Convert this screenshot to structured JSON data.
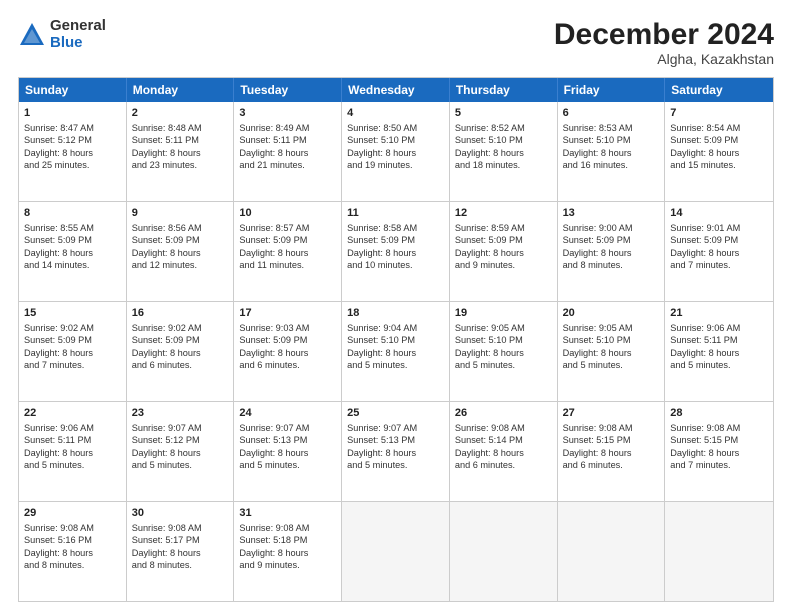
{
  "logo": {
    "general": "General",
    "blue": "Blue"
  },
  "title": "December 2024",
  "location": "Algha, Kazakhstan",
  "days_of_week": [
    "Sunday",
    "Monday",
    "Tuesday",
    "Wednesday",
    "Thursday",
    "Friday",
    "Saturday"
  ],
  "weeks": [
    [
      {
        "day": "1",
        "lines": [
          "Sunrise: 8:47 AM",
          "Sunset: 5:12 PM",
          "Daylight: 8 hours",
          "and 25 minutes."
        ]
      },
      {
        "day": "2",
        "lines": [
          "Sunrise: 8:48 AM",
          "Sunset: 5:11 PM",
          "Daylight: 8 hours",
          "and 23 minutes."
        ]
      },
      {
        "day": "3",
        "lines": [
          "Sunrise: 8:49 AM",
          "Sunset: 5:11 PM",
          "Daylight: 8 hours",
          "and 21 minutes."
        ]
      },
      {
        "day": "4",
        "lines": [
          "Sunrise: 8:50 AM",
          "Sunset: 5:10 PM",
          "Daylight: 8 hours",
          "and 19 minutes."
        ]
      },
      {
        "day": "5",
        "lines": [
          "Sunrise: 8:52 AM",
          "Sunset: 5:10 PM",
          "Daylight: 8 hours",
          "and 18 minutes."
        ]
      },
      {
        "day": "6",
        "lines": [
          "Sunrise: 8:53 AM",
          "Sunset: 5:10 PM",
          "Daylight: 8 hours",
          "and 16 minutes."
        ]
      },
      {
        "day": "7",
        "lines": [
          "Sunrise: 8:54 AM",
          "Sunset: 5:09 PM",
          "Daylight: 8 hours",
          "and 15 minutes."
        ]
      }
    ],
    [
      {
        "day": "8",
        "lines": [
          "Sunrise: 8:55 AM",
          "Sunset: 5:09 PM",
          "Daylight: 8 hours",
          "and 14 minutes."
        ]
      },
      {
        "day": "9",
        "lines": [
          "Sunrise: 8:56 AM",
          "Sunset: 5:09 PM",
          "Daylight: 8 hours",
          "and 12 minutes."
        ]
      },
      {
        "day": "10",
        "lines": [
          "Sunrise: 8:57 AM",
          "Sunset: 5:09 PM",
          "Daylight: 8 hours",
          "and 11 minutes."
        ]
      },
      {
        "day": "11",
        "lines": [
          "Sunrise: 8:58 AM",
          "Sunset: 5:09 PM",
          "Daylight: 8 hours",
          "and 10 minutes."
        ]
      },
      {
        "day": "12",
        "lines": [
          "Sunrise: 8:59 AM",
          "Sunset: 5:09 PM",
          "Daylight: 8 hours",
          "and 9 minutes."
        ]
      },
      {
        "day": "13",
        "lines": [
          "Sunrise: 9:00 AM",
          "Sunset: 5:09 PM",
          "Daylight: 8 hours",
          "and 8 minutes."
        ]
      },
      {
        "day": "14",
        "lines": [
          "Sunrise: 9:01 AM",
          "Sunset: 5:09 PM",
          "Daylight: 8 hours",
          "and 7 minutes."
        ]
      }
    ],
    [
      {
        "day": "15",
        "lines": [
          "Sunrise: 9:02 AM",
          "Sunset: 5:09 PM",
          "Daylight: 8 hours",
          "and 7 minutes."
        ]
      },
      {
        "day": "16",
        "lines": [
          "Sunrise: 9:02 AM",
          "Sunset: 5:09 PM",
          "Daylight: 8 hours",
          "and 6 minutes."
        ]
      },
      {
        "day": "17",
        "lines": [
          "Sunrise: 9:03 AM",
          "Sunset: 5:09 PM",
          "Daylight: 8 hours",
          "and 6 minutes."
        ]
      },
      {
        "day": "18",
        "lines": [
          "Sunrise: 9:04 AM",
          "Sunset: 5:10 PM",
          "Daylight: 8 hours",
          "and 5 minutes."
        ]
      },
      {
        "day": "19",
        "lines": [
          "Sunrise: 9:05 AM",
          "Sunset: 5:10 PM",
          "Daylight: 8 hours",
          "and 5 minutes."
        ]
      },
      {
        "day": "20",
        "lines": [
          "Sunrise: 9:05 AM",
          "Sunset: 5:10 PM",
          "Daylight: 8 hours",
          "and 5 minutes."
        ]
      },
      {
        "day": "21",
        "lines": [
          "Sunrise: 9:06 AM",
          "Sunset: 5:11 PM",
          "Daylight: 8 hours",
          "and 5 minutes."
        ]
      }
    ],
    [
      {
        "day": "22",
        "lines": [
          "Sunrise: 9:06 AM",
          "Sunset: 5:11 PM",
          "Daylight: 8 hours",
          "and 5 minutes."
        ]
      },
      {
        "day": "23",
        "lines": [
          "Sunrise: 9:07 AM",
          "Sunset: 5:12 PM",
          "Daylight: 8 hours",
          "and 5 minutes."
        ]
      },
      {
        "day": "24",
        "lines": [
          "Sunrise: 9:07 AM",
          "Sunset: 5:13 PM",
          "Daylight: 8 hours",
          "and 5 minutes."
        ]
      },
      {
        "day": "25",
        "lines": [
          "Sunrise: 9:07 AM",
          "Sunset: 5:13 PM",
          "Daylight: 8 hours",
          "and 5 minutes."
        ]
      },
      {
        "day": "26",
        "lines": [
          "Sunrise: 9:08 AM",
          "Sunset: 5:14 PM",
          "Daylight: 8 hours",
          "and 6 minutes."
        ]
      },
      {
        "day": "27",
        "lines": [
          "Sunrise: 9:08 AM",
          "Sunset: 5:15 PM",
          "Daylight: 8 hours",
          "and 6 minutes."
        ]
      },
      {
        "day": "28",
        "lines": [
          "Sunrise: 9:08 AM",
          "Sunset: 5:15 PM",
          "Daylight: 8 hours",
          "and 7 minutes."
        ]
      }
    ],
    [
      {
        "day": "29",
        "lines": [
          "Sunrise: 9:08 AM",
          "Sunset: 5:16 PM",
          "Daylight: 8 hours",
          "and 8 minutes."
        ]
      },
      {
        "day": "30",
        "lines": [
          "Sunrise: 9:08 AM",
          "Sunset: 5:17 PM",
          "Daylight: 8 hours",
          "and 8 minutes."
        ]
      },
      {
        "day": "31",
        "lines": [
          "Sunrise: 9:08 AM",
          "Sunset: 5:18 PM",
          "Daylight: 8 hours",
          "and 9 minutes."
        ]
      },
      {
        "day": "",
        "lines": []
      },
      {
        "day": "",
        "lines": []
      },
      {
        "day": "",
        "lines": []
      },
      {
        "day": "",
        "lines": []
      }
    ]
  ]
}
